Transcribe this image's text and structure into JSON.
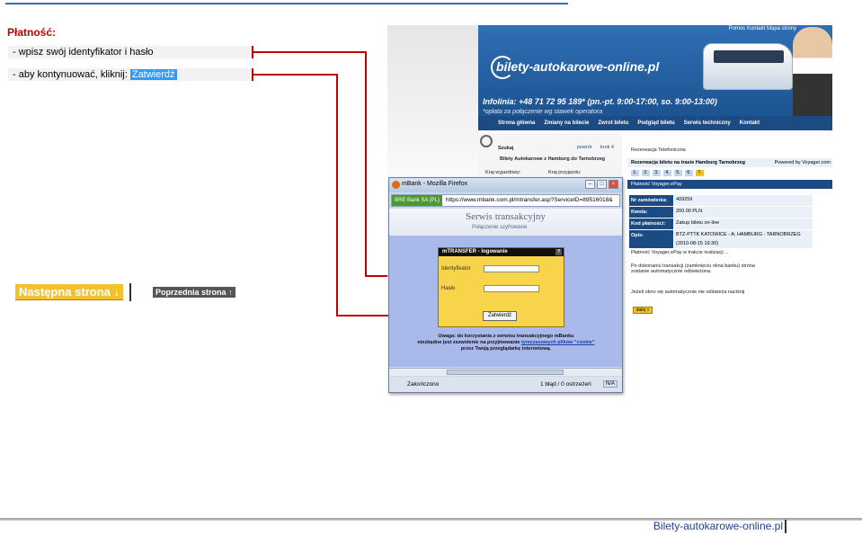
{
  "header": {
    "title": "Płatność:"
  },
  "steps": [
    {
      "text": "- wpisz swój identyfikator i hasło"
    },
    {
      "text": "- aby kontynuować, kliknij: ",
      "highlight": "Zatwierdź"
    }
  ],
  "nav": {
    "next_label": "Następna strona ↓",
    "prev_label": "Poprzednia strona ↑"
  },
  "footer": {
    "brand": "Bilety-autokarowe-online.pl"
  },
  "colors": {
    "accent": "#c00000",
    "brand": "#1f3f8f",
    "nav_next": "#f2c12e"
  },
  "site": {
    "logo": "bilety-autokarowe-online.pl",
    "topnav": "Pomoc  Kontakt  Mapa strony",
    "infolinia": "Infolinia: +48 71 72 95 189* (pn.-pt. 9:00-17:00, so. 9:00-13:00)",
    "infolinia_note": "*opłata za połączenie wg stawek operatora",
    "menu": [
      "Strona główna",
      "Zmiany na bilecie",
      "Zwrot biletu",
      "Podgląd biletu",
      "Serwis techniczny",
      "Kontakt"
    ],
    "search": {
      "label": "Szukaj",
      "back": "powrót",
      "step": "krok 4",
      "subtitle": "Bilety Autokarowe z Hamburg do Tarnobrzeg",
      "from": "Kraj wyjazdowy:",
      "to": "Kraj przyjazdu:"
    },
    "panel": {
      "title": "Rezerwacja Telefoniczna",
      "route": "Rezerwacja biletu na trasie Hamburg Tarnobrzeg",
      "powered": "Powered by Voyager.com",
      "steps": [
        "1.",
        "2.",
        "3.",
        "4.",
        "5.",
        "6.",
        "7."
      ],
      "pay_header": "Płatność Voyager.ePay",
      "rows": [
        {
          "key": "Nr zamówienia:",
          "value": "409259"
        },
        {
          "key": "Kwota:",
          "value": "200.00 PLN"
        },
        {
          "key": "Kod płatności:",
          "value": "Zakup biletu on-line"
        },
        {
          "key": "Opis:",
          "value": "BTZ-PTTK KATOWICE - A; HAMBURG - TARNOBRZEG (2010-08-15 19:30)"
        }
      ],
      "status": "Płatność Voyager.ePay w trakcie realizacji ...",
      "info": "Po dokonaniu transakcji (zamknięciu okna banku) strona zostanie automatycznie odświeżona.",
      "hint": "Jeżeli okno się automatycznie nie odświeża naciśnij",
      "next_btn": "dalej »"
    }
  },
  "browser": {
    "title": "mBank - Mozilla Firefox",
    "site_identity": "BRE Bank SA (PL)",
    "url": "https://www.mbank.com.pl/mtransfer.asp?ServiceID=89516018&",
    "banner_title": "Serwis transakcyjny",
    "banner_sub": "Połączenie szyfrowane",
    "login": {
      "header": "mTRANSFER - logowanie",
      "help": "?",
      "id_label": "Identyfikator",
      "id_value": "",
      "pw_label": "Hasło",
      "pw_value": "",
      "submit": "Zatwierdź"
    },
    "note_1": "Uwaga: do korzystania z serwisu transakcyjnego mBanku",
    "note_2": "niezbędne jest zezwolenie na przyjmowanie ",
    "note_link": "tymczasowych plików \"cookie\"",
    "note_3": "przez Twoją przeglądarkę internetową.",
    "status_left": "Zakończono",
    "status_right": "1 błąd / 0 ostrzeżeń",
    "status_na": "N/A"
  }
}
